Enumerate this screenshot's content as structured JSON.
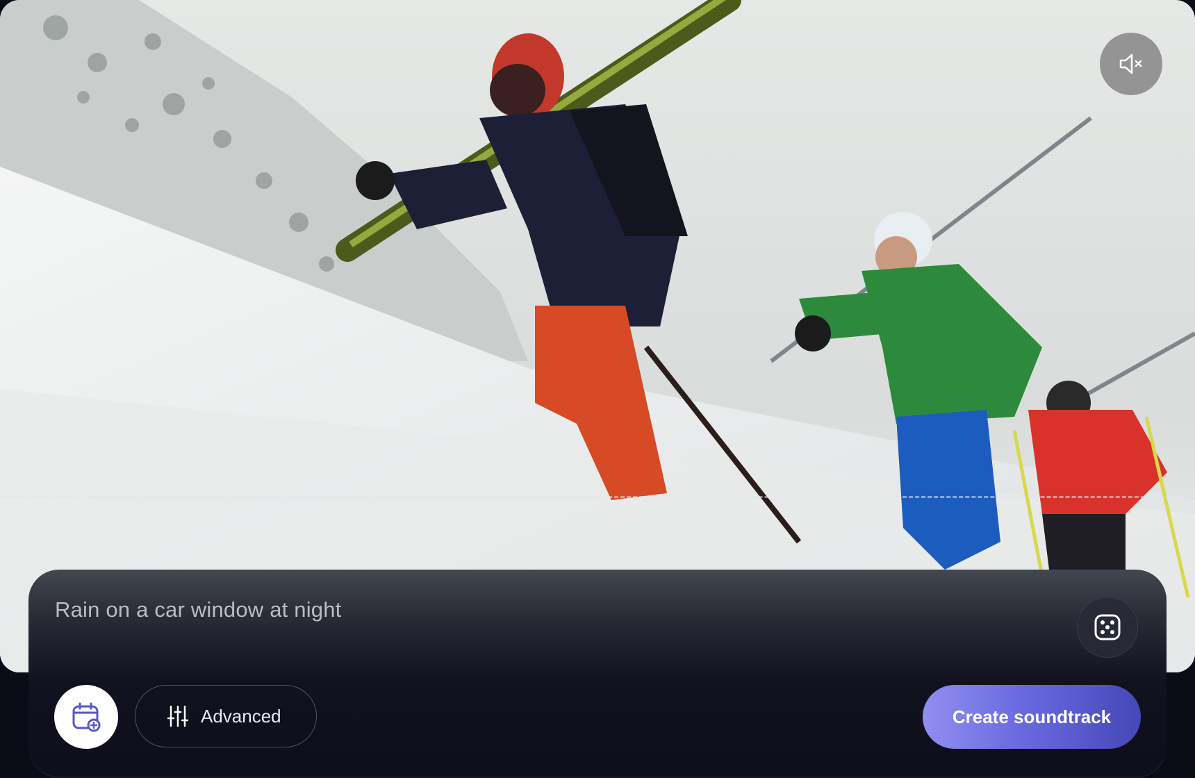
{
  "video": {
    "mute_icon": "speaker-muted-icon"
  },
  "prompt": {
    "text": "Rain on a car window at night",
    "dice_icon": "dice-icon"
  },
  "toolbar": {
    "calendar_icon": "calendar-add-icon",
    "advanced_icon": "sliders-icon",
    "advanced_label": "Advanced",
    "create_label": "Create soundtrack"
  },
  "colors": {
    "create_gradient_start": "#8f8ff0",
    "create_gradient_end": "#4448b8",
    "panel_bg": "#0e0e1c"
  }
}
